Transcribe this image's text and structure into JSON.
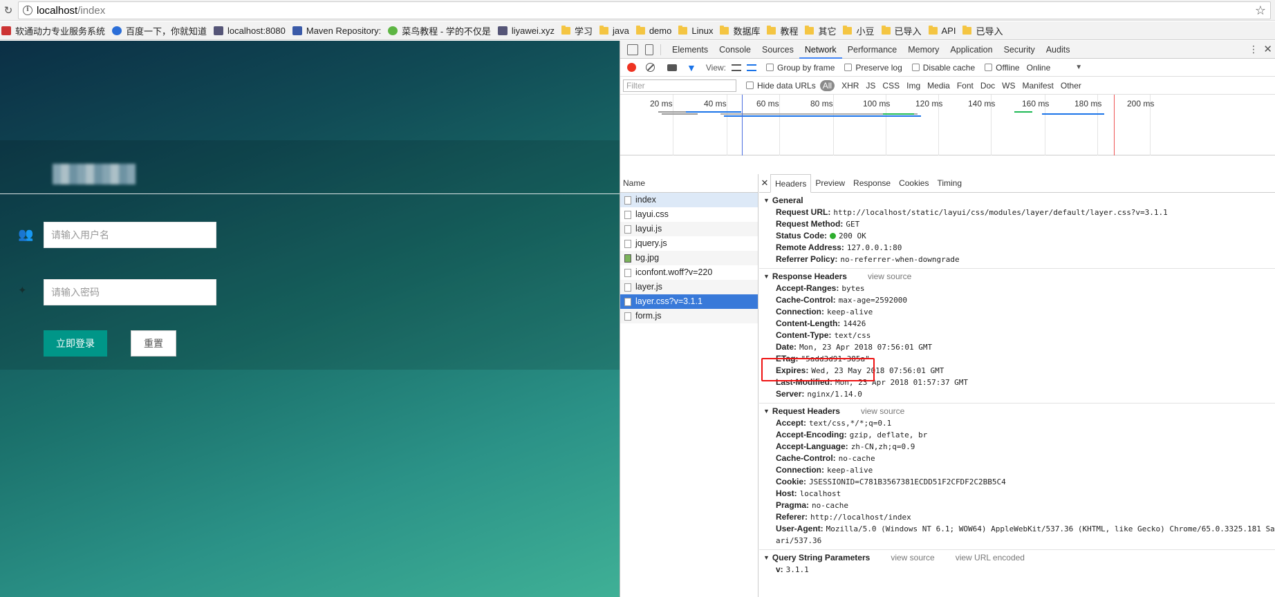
{
  "browser": {
    "url_host": "localhost",
    "url_path": "/index",
    "bookmarks": [
      {
        "label": "软通动力专业服务系统",
        "icon": "fav"
      },
      {
        "label": "百度一下，你就知道",
        "icon": "baidu"
      },
      {
        "label": "localhost:8080",
        "icon": "img"
      },
      {
        "label": "Maven Repository:",
        "icon": "mvn"
      },
      {
        "label": "菜鸟教程 - 学的不仅是",
        "icon": "green"
      },
      {
        "label": "liyawei.xyz",
        "icon": "img"
      },
      {
        "label": "学习",
        "icon": "folder"
      },
      {
        "label": "java",
        "icon": "folder"
      },
      {
        "label": "demo",
        "icon": "folder"
      },
      {
        "label": "Linux",
        "icon": "folder"
      },
      {
        "label": "数据库",
        "icon": "folder"
      },
      {
        "label": "教程",
        "icon": "folder"
      },
      {
        "label": "其它",
        "icon": "folder"
      },
      {
        "label": "小豆",
        "icon": "folder"
      },
      {
        "label": "已导入",
        "icon": "folder"
      },
      {
        "label": "API",
        "icon": "folder"
      },
      {
        "label": "已导入",
        "icon": "folder"
      }
    ]
  },
  "login": {
    "username_placeholder": "请输入用户名",
    "password_placeholder": "请输入密码",
    "login_label": "立即登录",
    "reset_label": "重置"
  },
  "devtools": {
    "tabs": [
      "Elements",
      "Console",
      "Sources",
      "Network",
      "Performance",
      "Memory",
      "Application",
      "Security",
      "Audits"
    ],
    "active_tab": "Network",
    "toolbar": {
      "view_label": "View:",
      "group_by_frame": "Group by frame",
      "preserve_log": "Preserve log",
      "disable_cache": "Disable cache",
      "offline": "Offline",
      "online": "Online"
    },
    "filter": {
      "placeholder": "Filter",
      "hide_data_urls": "Hide data URLs",
      "all": "All",
      "types": [
        "XHR",
        "JS",
        "CSS",
        "Img",
        "Media",
        "Font",
        "Doc",
        "WS",
        "Manifest",
        "Other"
      ]
    },
    "timeline_ticks": [
      "20 ms",
      "40 ms",
      "60 ms",
      "80 ms",
      "100 ms",
      "120 ms",
      "140 ms",
      "160 ms",
      "180 ms",
      "200 ms"
    ],
    "name_header": "Name",
    "requests": [
      {
        "name": "index",
        "type": "doc"
      },
      {
        "name": "layui.css",
        "type": "doc"
      },
      {
        "name": "layui.js",
        "type": "doc"
      },
      {
        "name": "jquery.js",
        "type": "doc"
      },
      {
        "name": "bg.jpg",
        "type": "img"
      },
      {
        "name": "iconfont.woff?v=220",
        "type": "doc"
      },
      {
        "name": "layer.js",
        "type": "doc"
      },
      {
        "name": "layer.css?v=3.1.1",
        "type": "doc"
      },
      {
        "name": "form.js",
        "type": "doc"
      }
    ],
    "selected_request": "layer.css?v=3.1.1",
    "detail_tabs": [
      "Headers",
      "Preview",
      "Response",
      "Cookies",
      "Timing"
    ],
    "general": {
      "title": "General",
      "rows": [
        {
          "k": "Request URL:",
          "v": "http://localhost/static/layui/css/modules/layer/default/layer.css?v=3.1.1"
        },
        {
          "k": "Request Method:",
          "v": "GET"
        },
        {
          "k": "Status Code:",
          "v": "200 OK"
        },
        {
          "k": "Remote Address:",
          "v": "127.0.0.1:80"
        },
        {
          "k": "Referrer Policy:",
          "v": "no-referrer-when-downgrade"
        }
      ]
    },
    "response_headers": {
      "title": "Response Headers",
      "view_source": "view source",
      "rows": [
        {
          "k": "Accept-Ranges:",
          "v": "bytes"
        },
        {
          "k": "Cache-Control:",
          "v": "max-age=2592000"
        },
        {
          "k": "Connection:",
          "v": "keep-alive"
        },
        {
          "k": "Content-Length:",
          "v": "14426"
        },
        {
          "k": "Content-Type:",
          "v": "text/css"
        },
        {
          "k": "Date:",
          "v": "Mon, 23 Apr 2018 07:56:01 GMT"
        },
        {
          "k": "ETag:",
          "v": "\"5add3d91-385a\""
        },
        {
          "k": "Expires:",
          "v": "Wed, 23 May 2018 07:56:01 GMT"
        },
        {
          "k": "Last-Modified:",
          "v": "Mon, 23 Apr 2018 01:57:37 GMT"
        },
        {
          "k": "Server:",
          "v": "nginx/1.14.0"
        }
      ]
    },
    "request_headers": {
      "title": "Request Headers",
      "view_source": "view source",
      "rows": [
        {
          "k": "Accept:",
          "v": "text/css,*/*;q=0.1"
        },
        {
          "k": "Accept-Encoding:",
          "v": "gzip, deflate, br"
        },
        {
          "k": "Accept-Language:",
          "v": "zh-CN,zh;q=0.9"
        },
        {
          "k": "Cache-Control:",
          "v": "no-cache"
        },
        {
          "k": "Connection:",
          "v": "keep-alive"
        },
        {
          "k": "Cookie:",
          "v": "JSESSIONID=C781B3567381ECDD51F2CFDF2C2BB5C4"
        },
        {
          "k": "Host:",
          "v": "localhost"
        },
        {
          "k": "Pragma:",
          "v": "no-cache"
        },
        {
          "k": "Referer:",
          "v": "http://localhost/index"
        },
        {
          "k": "User-Agent:",
          "v": "Mozilla/5.0 (Windows NT 6.1; WOW64) AppleWebKit/537.36 (KHTML, like Gecko) Chrome/65.0.3325.181 Saf"
        },
        {
          "k": "",
          "v": "ari/537.36"
        }
      ]
    },
    "query_params": {
      "title": "Query String Parameters",
      "view_source": "view source",
      "view_url_encoded": "view URL encoded",
      "rows": [
        {
          "k": "v:",
          "v": "3.1.1"
        }
      ]
    },
    "colors": {
      "accent": "#1a73e8",
      "login_button": "#009688",
      "highlight": "#e11111"
    }
  }
}
